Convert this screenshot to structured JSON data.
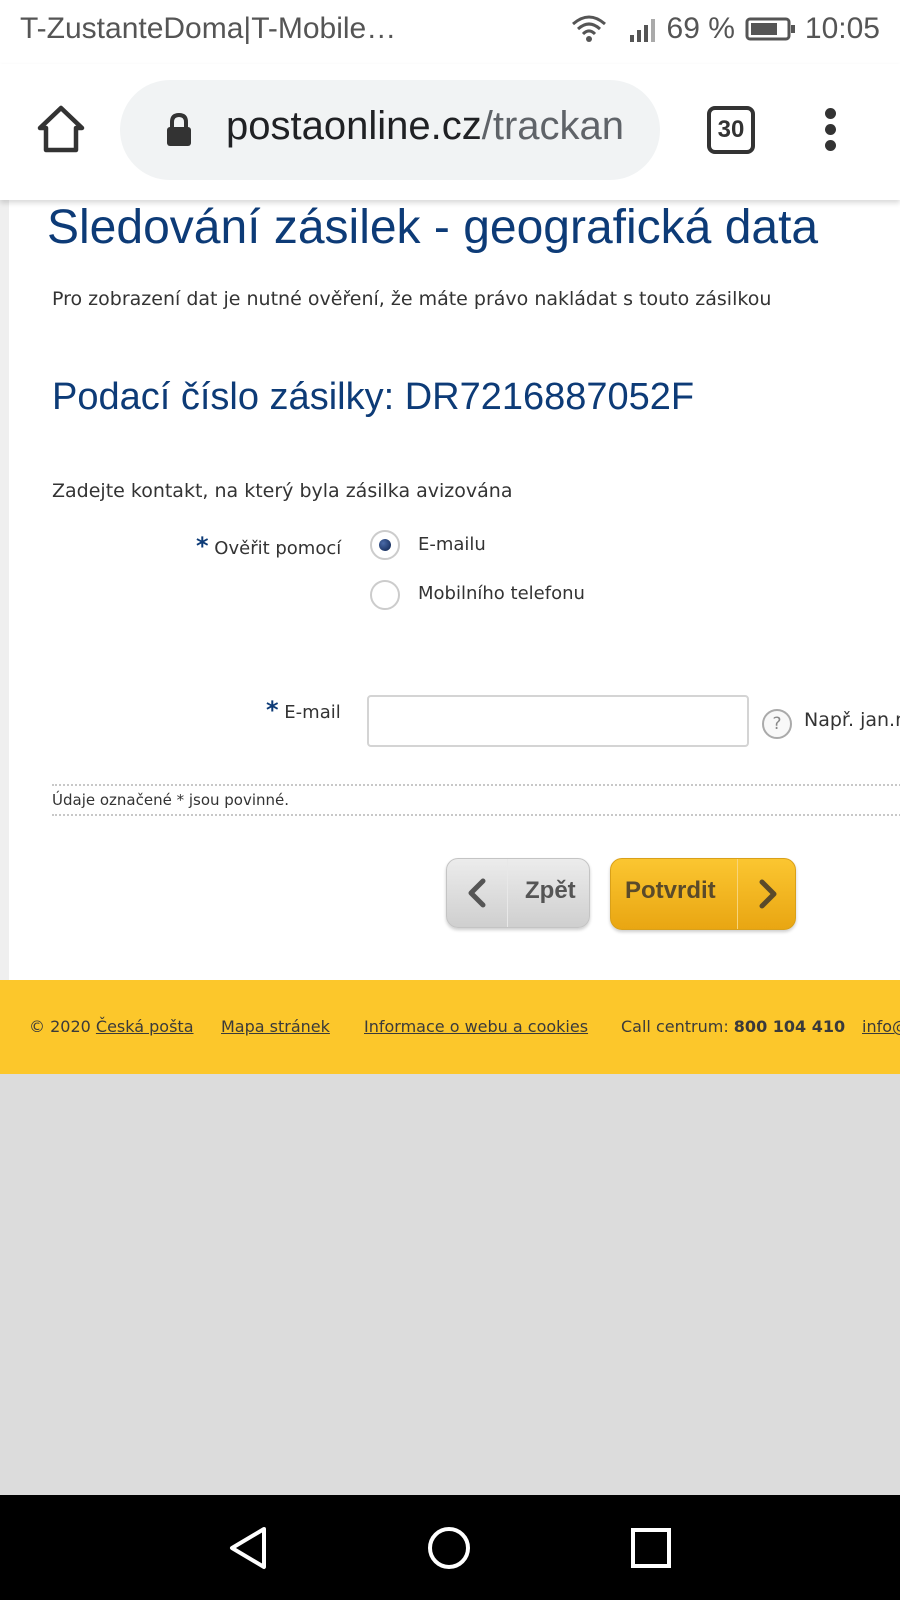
{
  "status_bar": {
    "carrier": "T-ZustanteDoma|T-Mobile…",
    "battery_percent": "69 %",
    "time": "10:05"
  },
  "browser": {
    "url_domain": "postaonline.cz",
    "url_path": "/trackan",
    "tab_count": "30"
  },
  "page": {
    "title": "Sledování zásilek - geografická data",
    "intro": "Pro zobrazení dat je nutné ověření, že máte právo nakládat s touto zásilkou",
    "parcel_heading": "Podací číslo zásilky: DR7216887052F",
    "instruction": "Zadejte kontakt, na který byla zásilka avizována",
    "verify": {
      "label": "Ověřit pomocí",
      "options": [
        "E-mailu",
        "Mobilního telefonu"
      ],
      "selected": "E-mailu"
    },
    "email": {
      "label": "E-mail",
      "value": "",
      "example": "Např. jan.n"
    },
    "required_note": "Údaje označené * jsou povinné.",
    "back_button": "Zpět",
    "confirm_button": "Potvrdit"
  },
  "footer": {
    "copyright": "© 2020",
    "brand_link": "Česká pošta",
    "sitemap_link": "Mapa stránek",
    "info_link": "Informace o webu a cookies",
    "call_label": "Call centrum:",
    "call_number": "800 104 410",
    "email_link": "info@"
  },
  "colors": {
    "brand_blue": "#0d3b77",
    "footer_yellow": "#fcc72b",
    "confirm_button": "#f5b81f"
  }
}
